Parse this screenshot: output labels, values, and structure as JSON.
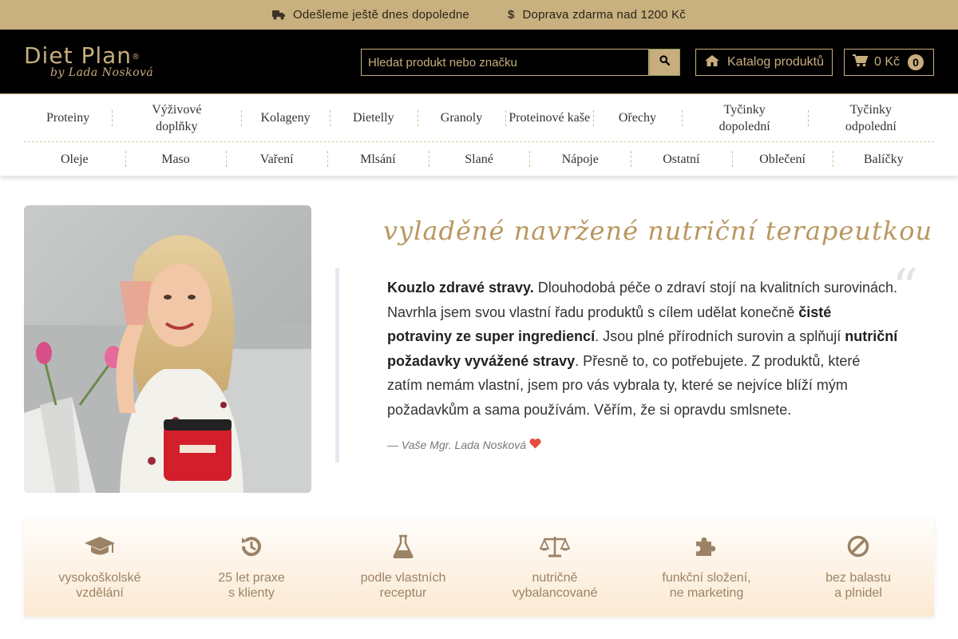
{
  "topbar": {
    "promo1": {
      "icon": "truck-icon",
      "text": "Odešleme ještě dnes dopoledne"
    },
    "promo2": {
      "icon": "dollar-icon",
      "text": "Doprava zdarma nad 1200 Kč"
    }
  },
  "header": {
    "logo_brand": "Diet Plan",
    "logo_reg": "®",
    "logo_sub": "by Lada Nosková",
    "search_placeholder": "Hledat produkt nebo značku",
    "catalog_label": "Katalog produktů",
    "cart_total": "0 Kč",
    "cart_count": "0"
  },
  "nav": {
    "row1": [
      "Proteiny",
      "Výživové doplňky",
      "Kolageny",
      "Dietelly",
      "Granoly",
      "Proteinové kaše",
      "Ořechy",
      "Tyčinky dopolední",
      "Tyčinky odpolední"
    ],
    "row2": [
      "Oleje",
      "Maso",
      "Vaření",
      "Mlsání",
      "Slané",
      "Nápoje",
      "Ostatní",
      "Oblečení",
      "Balíčky"
    ]
  },
  "main": {
    "heading": "vyladěné navržené nutriční terapeutkou",
    "quote_parts": [
      {
        "bold": true,
        "text": "Kouzlo zdravé stravy."
      },
      {
        "bold": false,
        "text": " Dlouhodobá péče o zdraví stojí na kvalitních surovinách. Navrhla jsem svou vlastní řadu produktů s cílem udělat konečně "
      },
      {
        "bold": true,
        "text": "čisté potraviny ze super ingrediencí"
      },
      {
        "bold": false,
        "text": ". Jsou plné přírodních surovin a splňují "
      },
      {
        "bold": true,
        "text": "nutriční požadavky vyvážené stravy"
      },
      {
        "bold": false,
        "text": ". Přesně to, co potřebujete. Z produktů, které zatím nemám vlastní, jsem pro vás vybrala ty, které se nejvíce blíží mým požadavkům a sama používám. Věřím, že si opravdu smlsnete."
      }
    ],
    "quote_mark": "“",
    "signature": "— Vaše Mgr. Lada Nosková",
    "signature_icon": "heart-icon"
  },
  "features": [
    {
      "icon": "graduation-cap-icon",
      "line1": "vysokoškolské",
      "line2": "vzdělání"
    },
    {
      "icon": "history-icon",
      "line1": "25 let praxe",
      "line2": "s klienty"
    },
    {
      "icon": "flask-icon",
      "line1": "podle vlastních",
      "line2": "receptur"
    },
    {
      "icon": "balance-scale-icon",
      "line1": "nutričně",
      "line2": "vybalancované"
    },
    {
      "icon": "puzzle-icon",
      "line1": "funkční složení,",
      "line2": "ne marketing"
    },
    {
      "icon": "ban-icon",
      "line1": "bez balastu",
      "line2": "a plnidel"
    }
  ],
  "colors": {
    "topbar_bg": "#c8b07f",
    "brand_gold": "#c8ad7f",
    "heading_gold": "#b9975f",
    "feature_text": "#9c8366",
    "heart": "#e74c3c"
  }
}
